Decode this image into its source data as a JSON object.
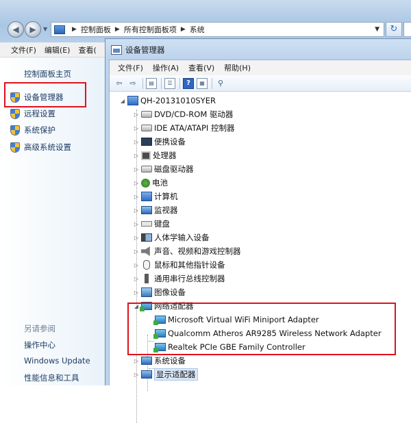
{
  "address_bar": {
    "segments": [
      "控制面板",
      "所有控制面板项",
      "系统"
    ]
  },
  "control_panel": {
    "menu": [
      "文件(F)",
      "编辑(E)",
      "查看("
    ],
    "home": "控制面板主页",
    "tasks": [
      "设备管理器",
      "远程设置",
      "系统保护",
      "高级系统设置"
    ],
    "see_also_heading": "另请参阅",
    "related_links": [
      "操作中心",
      "Windows Update",
      "性能信息和工具"
    ]
  },
  "device_manager": {
    "title": "设备管理器",
    "menu": [
      "文件(F)",
      "操作(A)",
      "查看(V)",
      "帮助(H)"
    ],
    "root": "QH-20131010SYER",
    "categories": [
      "DVD/CD-ROM 驱动器",
      "IDE ATA/ATAPI 控制器",
      "便携设备",
      "处理器",
      "磁盘驱动器",
      "电池",
      "计算机",
      "监视器",
      "键盘",
      "人体学输入设备",
      "声音、视频和游戏控制器",
      "鼠标和其他指针设备",
      "通用串行总线控制器",
      "图像设备",
      "网络适配器",
      "系统设备",
      "显示适配器"
    ],
    "network_adapters": [
      "Microsoft Virtual WiFi Miniport Adapter",
      "Qualcomm Atheros AR9285 Wireless Network Adapter",
      "Realtek PCIe GBE Family Controller"
    ]
  },
  "colors": {
    "highlight": "#e0101b",
    "link": "#1c3a63",
    "title_bar": "#bcd3ec"
  }
}
